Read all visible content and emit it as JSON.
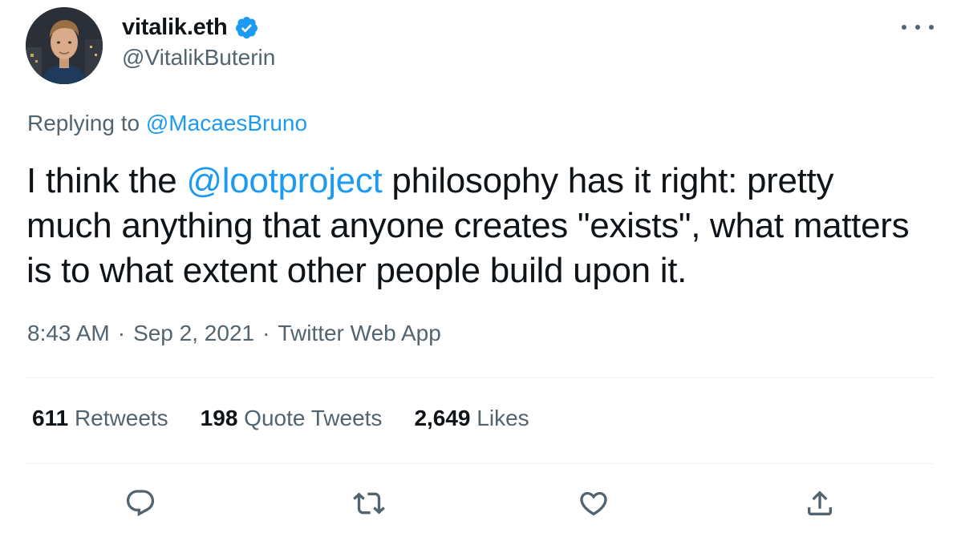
{
  "author": {
    "display_name": "vitalik.eth",
    "handle": "@VitalikButerin",
    "verified": true
  },
  "reply": {
    "prefix": "Replying to",
    "mention": "@MacaesBruno"
  },
  "tweet": {
    "text_before": "I think the ",
    "mention": "@lootproject",
    "text_after": " philosophy has it right: pretty much anything that anyone creates \"exists\", what matters is to what extent other people build upon it."
  },
  "meta": {
    "time": "8:43 AM",
    "separator": "·",
    "date": "Sep 2, 2021",
    "source": "Twitter Web App"
  },
  "stats": {
    "retweets": {
      "count": "611",
      "label": "Retweets"
    },
    "quotes": {
      "count": "198",
      "label": "Quote Tweets"
    },
    "likes": {
      "count": "2,649",
      "label": "Likes"
    }
  },
  "colors": {
    "link": "#1d9bf0",
    "secondary_text": "#536471",
    "primary_text": "#0f1419",
    "divider": "#eff3f4"
  },
  "icons": {
    "verified": "verified-badge-icon",
    "more": "more-options-icon",
    "reply": "reply-icon",
    "retweet": "retweet-icon",
    "like": "heart-icon",
    "share": "share-icon"
  }
}
